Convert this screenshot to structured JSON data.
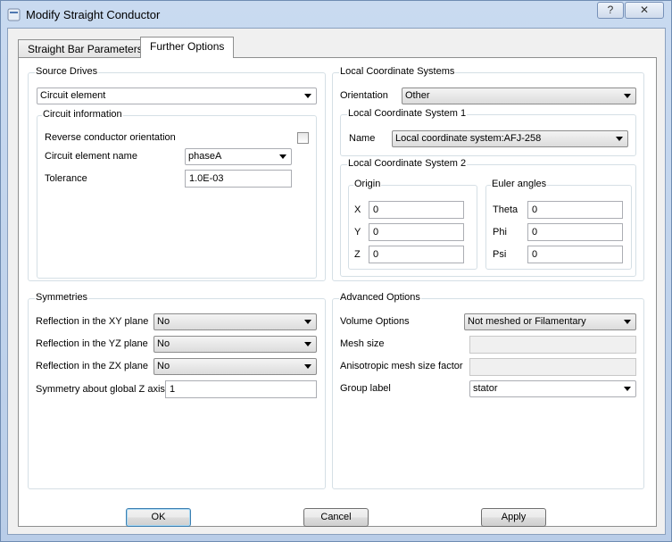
{
  "window": {
    "title": "Modify Straight Conductor",
    "help": "?",
    "close": "✕"
  },
  "tabs": [
    {
      "label": "Straight Bar Parameters"
    },
    {
      "label": "Further Options"
    }
  ],
  "source_drives": {
    "title": "Source Drives",
    "drive": "Circuit element",
    "circuit_info": {
      "title": "Circuit information",
      "reverse_label": "Reverse conductor orientation",
      "reverse_checked": false,
      "name_label": "Circuit element name",
      "name_value": "phaseA",
      "tolerance_label": "Tolerance",
      "tolerance_value": "1.0E-03"
    }
  },
  "lcs": {
    "title": "Local Coordinate Systems",
    "orientation_label": "Orientation",
    "orientation_value": "Other",
    "lcs1": {
      "title": "Local Coordinate System 1",
      "name_label": "Name",
      "name_value": "Local coordinate system:AFJ-258"
    },
    "lcs2": {
      "title": "Local Coordinate System 2",
      "origin": {
        "title": "Origin",
        "x_label": "X",
        "x": "0",
        "y_label": "Y",
        "y": "0",
        "z_label": "Z",
        "z": "0"
      },
      "euler": {
        "title": "Euler angles",
        "theta_label": "Theta",
        "theta": "0",
        "phi_label": "Phi",
        "phi": "0",
        "psi_label": "Psi",
        "psi": "0"
      }
    }
  },
  "symmetries": {
    "title": "Symmetries",
    "xy_label": "Reflection in the XY plane",
    "xy_value": "No",
    "yz_label": "Reflection in the YZ plane",
    "yz_value": "No",
    "zx_label": "Reflection in the ZX plane",
    "zx_value": "No",
    "z_axis_label": "Symmetry about global Z axis",
    "z_axis_value": "1"
  },
  "advanced": {
    "title": "Advanced Options",
    "volume_label": "Volume Options",
    "volume_value": "Not meshed or Filamentary",
    "mesh_label": "Mesh size",
    "mesh_value": "",
    "aniso_label": "Anisotropic mesh size factor",
    "aniso_value": "",
    "group_label": "Group label",
    "group_value": "stator"
  },
  "buttons": {
    "ok": "OK",
    "cancel": "Cancel",
    "apply": "Apply"
  }
}
